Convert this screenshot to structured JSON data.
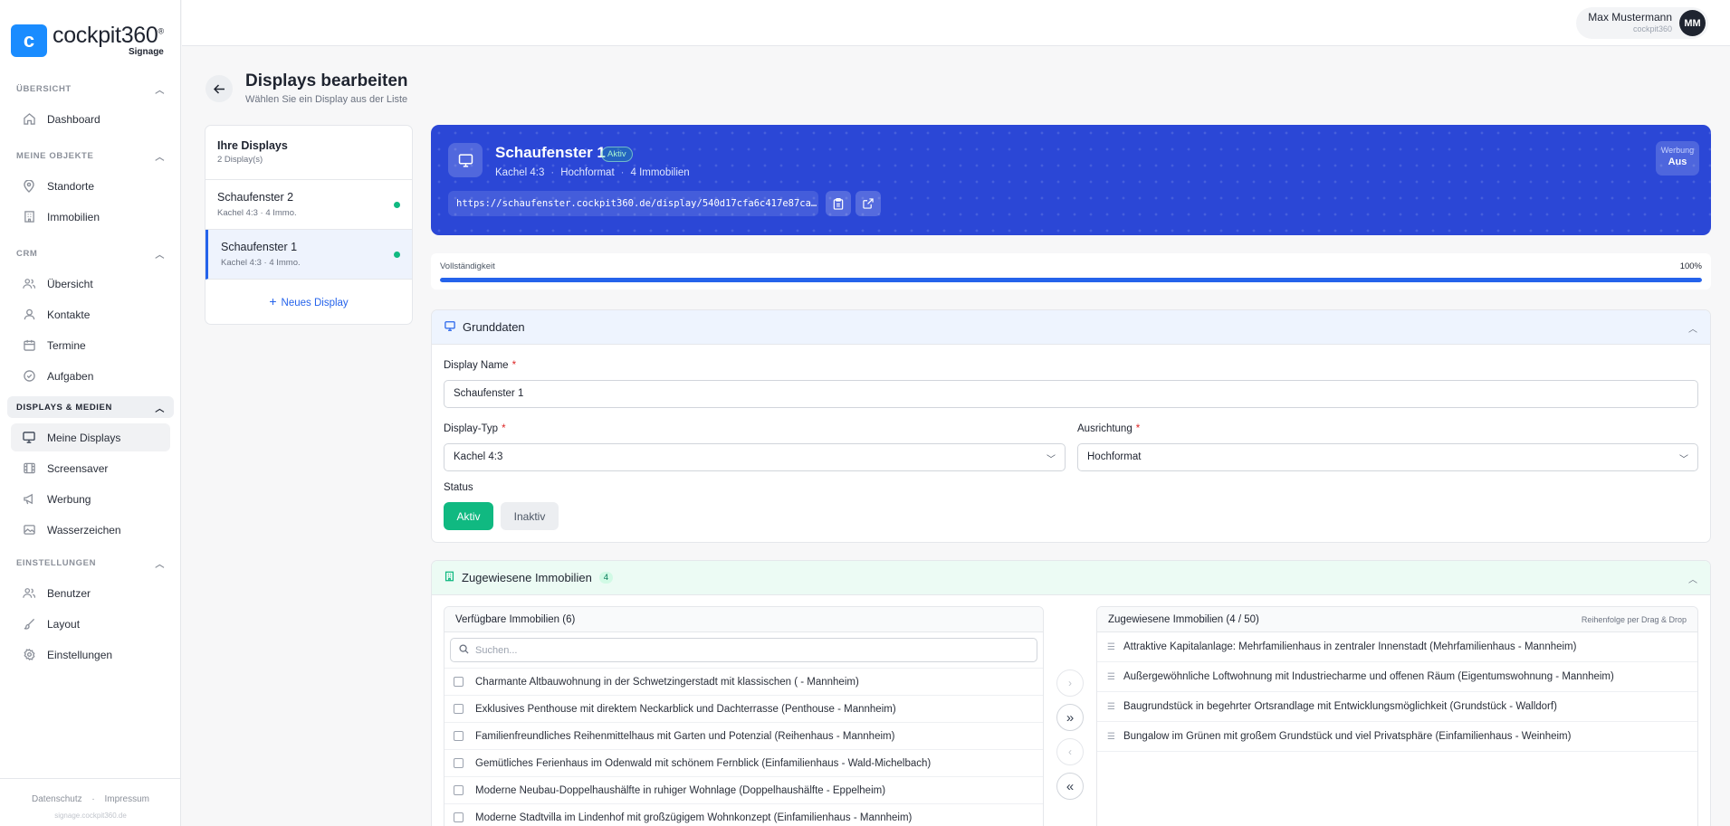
{
  "brand": {
    "name": "cockpit360",
    "mark": "®",
    "sub": "Signage",
    "letter": "c"
  },
  "user": {
    "name": "Max Mustermann",
    "org": "cockpit360",
    "initials": "MM"
  },
  "sidebar": {
    "sections": [
      {
        "label": "ÜBERSICHT",
        "items": [
          {
            "label": "Dashboard",
            "icon": "dashboard-icon"
          }
        ]
      },
      {
        "label": "MEINE OBJEKTE",
        "items": [
          {
            "label": "Standorte",
            "icon": "map-pin-icon"
          },
          {
            "label": "Immobilien",
            "icon": "building-icon"
          }
        ]
      },
      {
        "label": "CRM",
        "items": [
          {
            "label": "Übersicht",
            "icon": "users-icon"
          },
          {
            "label": "Kontakte",
            "icon": "contact-icon"
          },
          {
            "label": "Termine",
            "icon": "calendar-icon"
          },
          {
            "label": "Aufgaben",
            "icon": "check-circle-icon"
          }
        ]
      },
      {
        "label": "DISPLAYS & MEDIEN",
        "items": [
          {
            "label": "Meine Displays",
            "icon": "monitor-icon"
          },
          {
            "label": "Screensaver",
            "icon": "film-icon"
          },
          {
            "label": "Werbung",
            "icon": "megaphone-icon"
          },
          {
            "label": "Wasserzeichen",
            "icon": "image-icon"
          }
        ]
      },
      {
        "label": "EINSTELLUNGEN",
        "items": [
          {
            "label": "Benutzer",
            "icon": "user-group-icon"
          },
          {
            "label": "Layout",
            "icon": "brush-icon"
          },
          {
            "label": "Einstellungen",
            "icon": "gear-icon"
          }
        ]
      }
    ],
    "footer": {
      "privacy": "Datenschutz",
      "dot": "·",
      "imprint": "Impressum",
      "domain": "signage.cockpit360.de"
    }
  },
  "page": {
    "title": "Displays bearbeiten",
    "subtitle": "Wählen Sie ein Display aus der Liste"
  },
  "display_list": {
    "title": "Ihre Displays",
    "count": "2 Display(s)",
    "items": [
      {
        "name": "Schaufenster 2",
        "meta": "Kachel 4:3 · 4 Immo."
      },
      {
        "name": "Schaufenster 1",
        "meta": "Kachel 4:3 · 4 Immo."
      }
    ],
    "new_label": "Neues Display"
  },
  "hero": {
    "title": "Schaufenster 1",
    "badge": "Aktiv",
    "meta": [
      "Kachel 4:3",
      "Hochformat",
      "4 Immobilien"
    ],
    "url": "https://schaufenster.cockpit360.de/display/540d17cfa6c417e87ca…",
    "ad_label": "Werbung",
    "ad_value": "Aus"
  },
  "progress": {
    "label": "Vollständigkeit",
    "value_text": "100%",
    "value": 1.0
  },
  "grunddaten": {
    "title": "Grunddaten",
    "name_label": "Display Name",
    "name_value": "Schaufenster 1",
    "type_label": "Display-Typ",
    "type_value": "Kachel 4:3",
    "orient_label": "Ausrichtung",
    "orient_value": "Hochformat",
    "status_label": "Status",
    "status_active": "Aktiv",
    "status_inactive": "Inaktiv"
  },
  "immobilien": {
    "title": "Zugewiesene Immobilien",
    "count": "4",
    "available_title": "Verfügbare Immobilien (6)",
    "search_placeholder": "Suchen...",
    "available": [
      "Charmante Altbauwohnung in der Schwetzingerstadt mit klassischen ( - Mannheim)",
      "Exklusives Penthouse mit direktem Neckarblick und Dachterrasse (Penthouse - Mannheim)",
      "Familienfreundliches Reihenmittelhaus mit Garten und Potenzial (Reihenhaus - Mannheim)",
      "Gemütliches Ferienhaus im Odenwald mit schönem Fernblick (Einfamilienhaus - Wald-Michelbach)",
      "Moderne Neubau-Doppelhaushälfte in ruhiger Wohnlage (Doppelhaushälfte - Eppelheim)",
      "Moderne Stadtvilla im Lindenhof mit großzügigem Wohnkonzept (Einfamilienhaus - Mannheim)"
    ],
    "assigned_title": "Zugewiesene Immobilien (4 / 50)",
    "assigned_hint": "Reihenfolge per Drag & Drop",
    "assigned": [
      "Attraktive Kapitalanlage: Mehrfamilienhaus in zentraler Innenstadt (Mehrfamilienhaus - Mannheim)",
      "Außergewöhnliche Loftwohnung mit Industriecharme und offenen Räum (Eigentumswohnung - Mannheim)",
      "Baugrundstück in begehrter Ortsrandlage mit Entwicklungsmöglichkeit (Grundstück - Walldorf)",
      "Bungalow im Grünen mit großem Grundstück und viel Privatsphäre (Einfamilienhaus - Weinheim)"
    ]
  },
  "colors": {
    "accent": "#2563eb",
    "hero": "#2b47d6",
    "success": "#10b981",
    "logo": "#1a8cff"
  }
}
